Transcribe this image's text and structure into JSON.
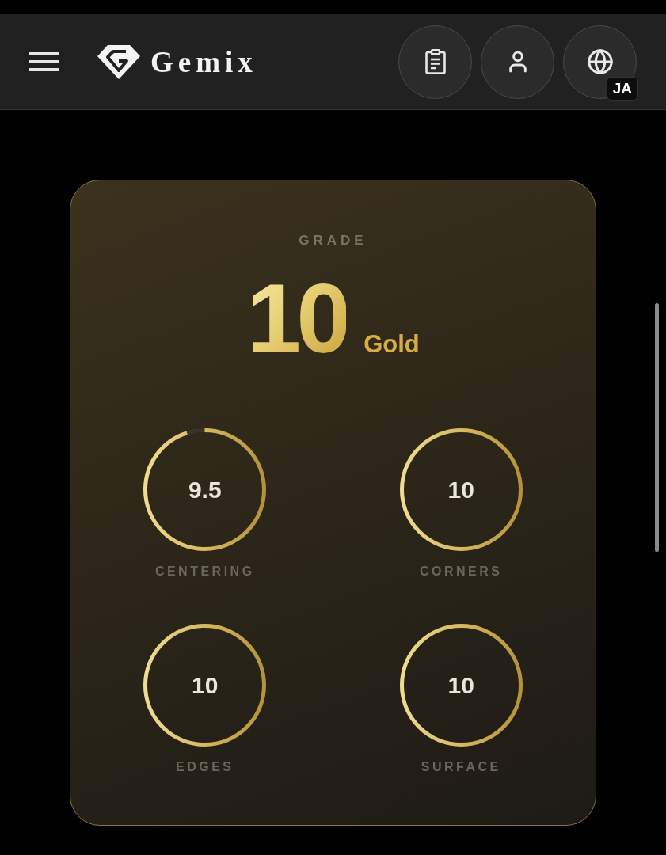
{
  "header": {
    "logo_text": "Gemix",
    "language_badge": "JA"
  },
  "grade_card": {
    "label": "GRADE",
    "score": "10",
    "tier": "Gold",
    "subgrades": [
      {
        "label": "CENTERING",
        "score": "9.5",
        "level": 0.95
      },
      {
        "label": "CORNERS",
        "score": "10",
        "level": 1
      },
      {
        "label": "EDGES",
        "score": "10",
        "level": 1
      },
      {
        "label": "SURFACE",
        "score": "10",
        "level": 1
      }
    ]
  }
}
